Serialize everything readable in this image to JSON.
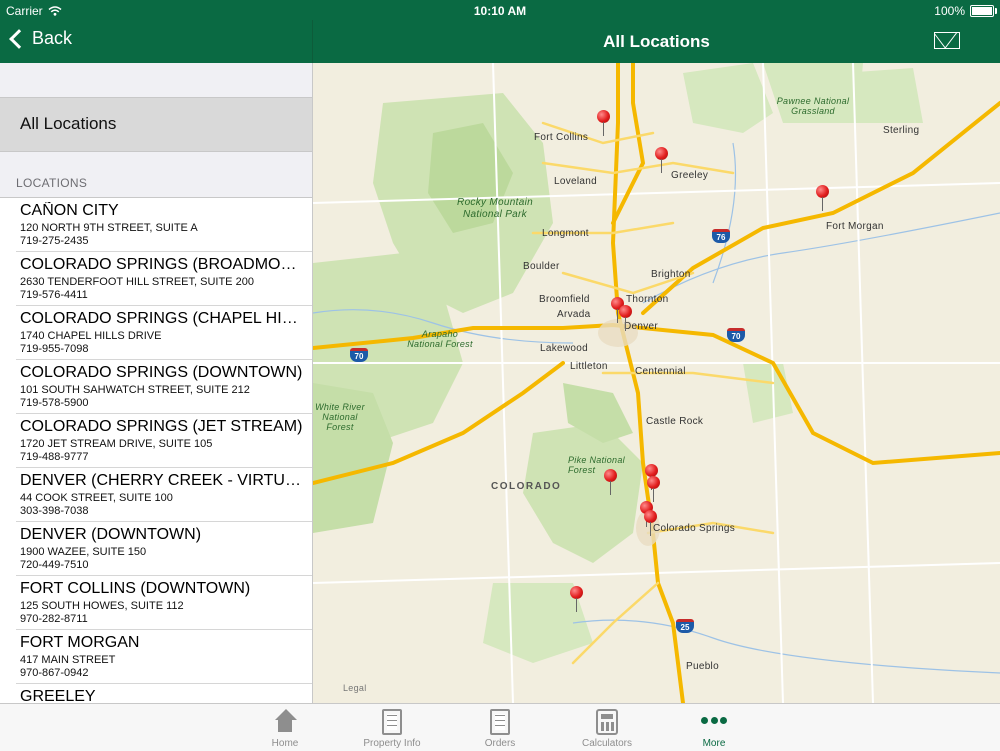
{
  "status": {
    "carrier": "Carrier",
    "time": "10:10 AM",
    "battery": "100%"
  },
  "nav": {
    "back_label": "Back",
    "title": "All Locations"
  },
  "sidebar": {
    "all_locations": "All Locations",
    "section_header": "LOCATIONS",
    "items": [
      {
        "name": "CAÑON CITY",
        "address": "120 NORTH 9TH STREET, SUITE A",
        "phone": "719-275-2435"
      },
      {
        "name": "COLORADO SPRINGS (BROADMOOR)",
        "address": "2630 TENDERFOOT HILL STREET, SUITE 200",
        "phone": "719-576-4411"
      },
      {
        "name": "COLORADO SPRINGS (CHAPEL HILLS)",
        "address": "1740 CHAPEL HILLS DRIVE",
        "phone": "719-955-7098"
      },
      {
        "name": "COLORADO SPRINGS (DOWNTOWN)",
        "address": "101 SOUTH SAHWATCH STREET, SUITE 212",
        "phone": "719-578-5900"
      },
      {
        "name": "COLORADO SPRINGS (JET STREAM)",
        "address": "1720 JET STREAM DRIVE, SUITE 105",
        "phone": "719-488-9777"
      },
      {
        "name": "DENVER (CHERRY CREEK - VIRTUAL)",
        "address": "44 COOK STREET, SUITE 100",
        "phone": "303-398-7038"
      },
      {
        "name": "DENVER (DOWNTOWN)",
        "address": "1900 WAZEE, SUITE 150",
        "phone": "720-449-7510"
      },
      {
        "name": "FORT COLLINS (DOWNTOWN)",
        "address": "125 SOUTH HOWES, SUITE 112",
        "phone": "970-282-8711"
      },
      {
        "name": "FORT MORGAN",
        "address": "417 MAIN STREET",
        "phone": "970-867-0942"
      },
      {
        "name": "GREELEY",
        "address": "",
        "phone": ""
      }
    ]
  },
  "map": {
    "labels": {
      "fort_collins": "Fort Collins",
      "greeley": "Greeley",
      "loveland": "Loveland",
      "longmont": "Longmont",
      "boulder": "Boulder",
      "brighton": "Brighton",
      "broomfield": "Broomfield",
      "thornton": "Thornton",
      "arvada": "Arvada",
      "denver": "Denver",
      "lakewood": "Lakewood",
      "littleton": "Littleton",
      "centennial": "Centennial",
      "castle_rock": "Castle Rock",
      "colorado_springs": "Colorado Springs",
      "pueblo": "Pueblo",
      "sterling": "Sterling",
      "fort_morgan": "Fort Morgan",
      "rocky_mountain": "Rocky Mountain National Park",
      "pawnee": "Pawnee National Grassland",
      "arapaho": "Arapaho National Forest",
      "white_river": "White River National Forest",
      "pike": "Pike National Forest",
      "colorado": "COLORADO",
      "legal": "Legal"
    },
    "shields": {
      "i70_west": "70",
      "i70_east": "70",
      "i76": "76",
      "i25": "25"
    }
  },
  "tabs": [
    {
      "label": "Home",
      "icon": "home-icon"
    },
    {
      "label": "Property Info",
      "icon": "document-icon"
    },
    {
      "label": "Orders",
      "icon": "orders-icon"
    },
    {
      "label": "Calculators",
      "icon": "calculator-icon"
    },
    {
      "label": "More",
      "icon": "more-dots-icon"
    }
  ],
  "colors": {
    "brand": "#0a6a43",
    "pin": "#e11d1d",
    "highway": "#f5b800"
  }
}
